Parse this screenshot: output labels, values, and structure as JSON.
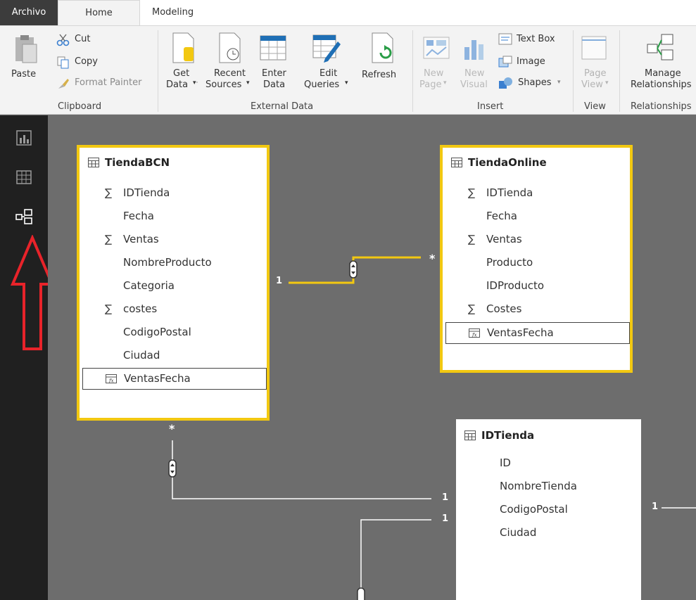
{
  "tabs": {
    "file": "Archivo",
    "home": "Home",
    "modeling": "Modeling"
  },
  "ribbon": {
    "paste": "Paste",
    "cut": "Cut",
    "copy": "Copy",
    "format_painter": "Format Painter",
    "clipboard_group": "Clipboard",
    "get_data_1": "Get",
    "get_data_2": "Data",
    "recent_sources_1": "Recent",
    "recent_sources_2": "Sources",
    "enter_data_1": "Enter",
    "enter_data_2": "Data",
    "edit_queries_1": "Edit",
    "edit_queries_2": "Queries",
    "refresh": "Refresh",
    "external_data_group": "External Data",
    "new_page_1": "New",
    "new_page_2": "Page",
    "new_visual_1": "New",
    "new_visual_2": "Visual",
    "text_box": "Text Box",
    "image": "Image",
    "shapes": "Shapes",
    "insert_group": "Insert",
    "page_view_1": "Page",
    "page_view_2": "View",
    "view_group": "View",
    "manage_rel_1": "Manage",
    "manage_rel_2": "Relationships",
    "relationships_group": "Relationships"
  },
  "tables": {
    "tiendabcn": {
      "title": "TiendaBCN",
      "fields": [
        "IDTienda",
        "Fecha",
        "Ventas",
        "NombreProducto",
        "Categoria",
        "costes",
        "CodigoPostal",
        "Ciudad"
      ],
      "measure": "VentasFecha"
    },
    "tiendaonline": {
      "title": "TiendaOnline",
      "fields": [
        "IDTienda",
        "Fecha",
        "Ventas",
        "Producto",
        "IDProducto",
        "Costes"
      ],
      "measure": "VentasFecha"
    },
    "idtienda": {
      "title": "IDTienda",
      "fields": [
        "ID",
        "NombreTienda",
        "CodigoPostal",
        "Ciudad"
      ]
    }
  },
  "relationships": {
    "one": "1",
    "many": "*"
  },
  "colors": {
    "selected_border": "#f2c811",
    "canvas": "#6d6d6d",
    "rail": "#202020",
    "arrow": "#e8232a"
  }
}
